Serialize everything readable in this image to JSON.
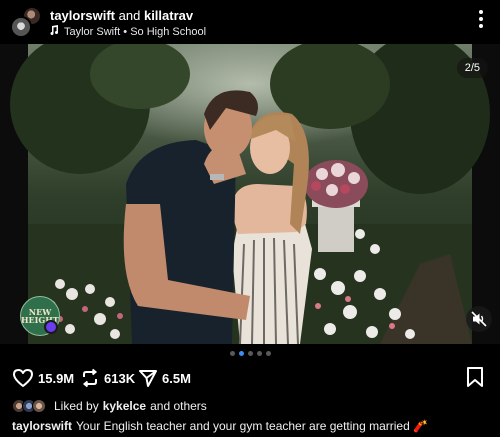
{
  "post": {
    "author": "taylorswift",
    "connector": "and",
    "coauthor": "killatrav",
    "audio": "Taylor Swift • So High School",
    "carousel": {
      "current_label": "2/5",
      "current": 2,
      "total": 5
    },
    "badge_text": "NEW HEIGHTS"
  },
  "actions": {
    "likes": "15.9M",
    "reposts": "613K",
    "shares": "6.5M"
  },
  "liked_by": {
    "prefix": "Liked by",
    "user": "kykelce",
    "suffix": "and others"
  },
  "caption": {
    "user": "taylorswift",
    "text": "Your English teacher and your gym teacher are getting married 🧨"
  },
  "icons": {
    "audio": "music-note-icon",
    "more": "more-vertical-icon",
    "like": "heart-icon",
    "repost": "repost-icon",
    "share": "send-icon",
    "save": "bookmark-icon",
    "mute": "speaker-muted-icon"
  },
  "colors": {
    "background": "#000000",
    "active_dot": "#3b8cf6",
    "inactive_dot": "#5a5a5a",
    "badge": "#2f6f4c",
    "badge_dot": "#6a3df0"
  }
}
